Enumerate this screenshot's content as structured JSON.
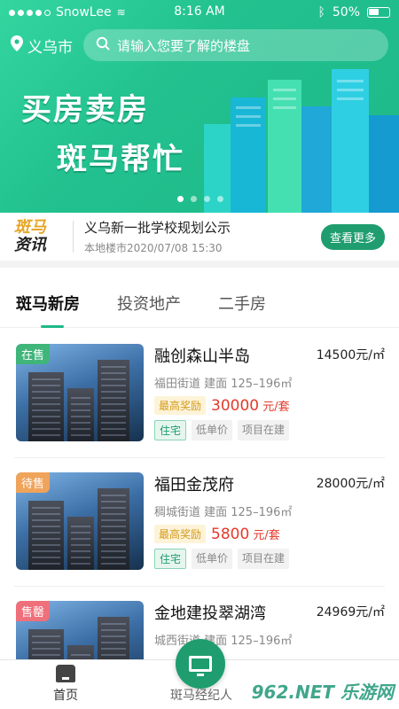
{
  "status_bar": {
    "carrier": "SnowLee",
    "time": "8:16 AM",
    "battery": "50%"
  },
  "header": {
    "location": "义乌市",
    "search_placeholder": "请输入您要了解的楼盘",
    "banner_line1": "买房卖房",
    "banner_line2": "斑马帮忙"
  },
  "news": {
    "logo_line1": "斑马",
    "logo_line2": "资讯",
    "title": "义乌新一批学校规划公示",
    "subtitle": "本地楼市2020/07/08 15:30",
    "more_label": "查看更多"
  },
  "tabs": [
    {
      "label": "斑马新房"
    },
    {
      "label": "投资地产"
    },
    {
      "label": "二手房"
    }
  ],
  "listings": [
    {
      "status": "在售",
      "status_color": "#3fb57a",
      "name": "融创森山半岛",
      "price": "14500元/㎡",
      "meta": "福田街道  建面 125–196㎡",
      "reward_label": "最高奖励",
      "reward_value": "30000",
      "reward_unit": " 元/套",
      "tags": [
        "住宅",
        "低单价",
        "项目在建"
      ]
    },
    {
      "status": "待售",
      "status_color": "#f0a35a",
      "name": "福田金茂府",
      "price": "28000元/㎡",
      "meta": "稠城街道  建面 125–196㎡",
      "reward_label": "最高奖励",
      "reward_value": "5800",
      "reward_unit": " 元/套",
      "tags": [
        "住宅",
        "低单价",
        "项目在建"
      ]
    },
    {
      "status": "售罄",
      "status_color": "#ef6f7a",
      "name": "金地建投翠湖湾",
      "price": "24969元/㎡",
      "meta": "城西街道  建面 125–196㎡",
      "reward_label": "",
      "reward_value": "",
      "reward_unit": "",
      "tags": []
    }
  ],
  "bottom_nav": {
    "home_label": "首页",
    "agent_label": "斑马经纪人"
  },
  "watermark": "962.NET 乐游网"
}
